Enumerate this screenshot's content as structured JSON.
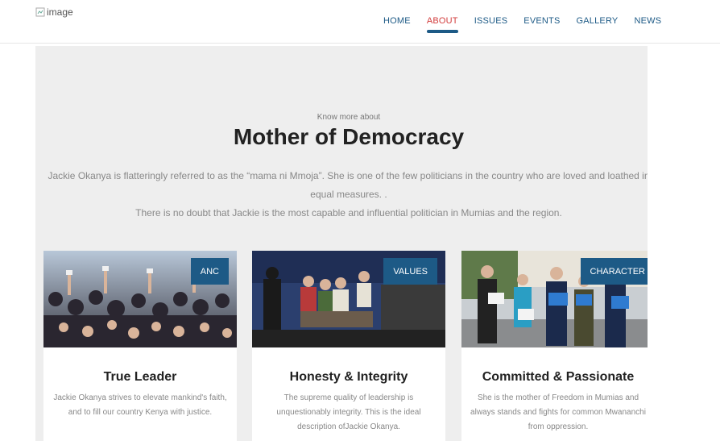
{
  "header": {
    "logo_alt": "image",
    "nav": [
      {
        "label": "HOME",
        "active": false
      },
      {
        "label": "ABOUT",
        "active": true
      },
      {
        "label": "ISSUES",
        "active": false
      },
      {
        "label": "EVENTS",
        "active": false
      },
      {
        "label": "GALLERY",
        "active": false
      },
      {
        "label": "NEWS",
        "active": false
      }
    ]
  },
  "hero": {
    "kicker": "Know more about",
    "title": "Mother of Democracy",
    "line1": "Jackie Okanya is flatteringly referred to as the “mama ni Mmoja”. She is one of the few politicians in the country who are loved and loathed in",
    "line2": "equal measures. .",
    "line3": "There is no doubt that Jackie is the most capable and influential politician in Mumias and the region."
  },
  "cards": [
    {
      "tag": "ANC",
      "title": "True Leader",
      "desc": "Jackie Okanya strives to elevate mankind's faith, and to fill our country Kenya with justice."
    },
    {
      "tag": "VALUES",
      "title": "Honesty & Integrity",
      "desc": "The supreme quality of leadership is unquestionably integrity. This is the ideal description ofJackie Okanya."
    },
    {
      "tag": "CHARACTER",
      "title": "Committed & Passionate",
      "desc": "She is the mother of Freedom in Mumias and always stands and fights for common Mwananchi from oppression."
    }
  ],
  "colors": {
    "accent": "#1d5a86",
    "active_nav": "#d23c3c",
    "section_bg": "#eeeeee"
  }
}
